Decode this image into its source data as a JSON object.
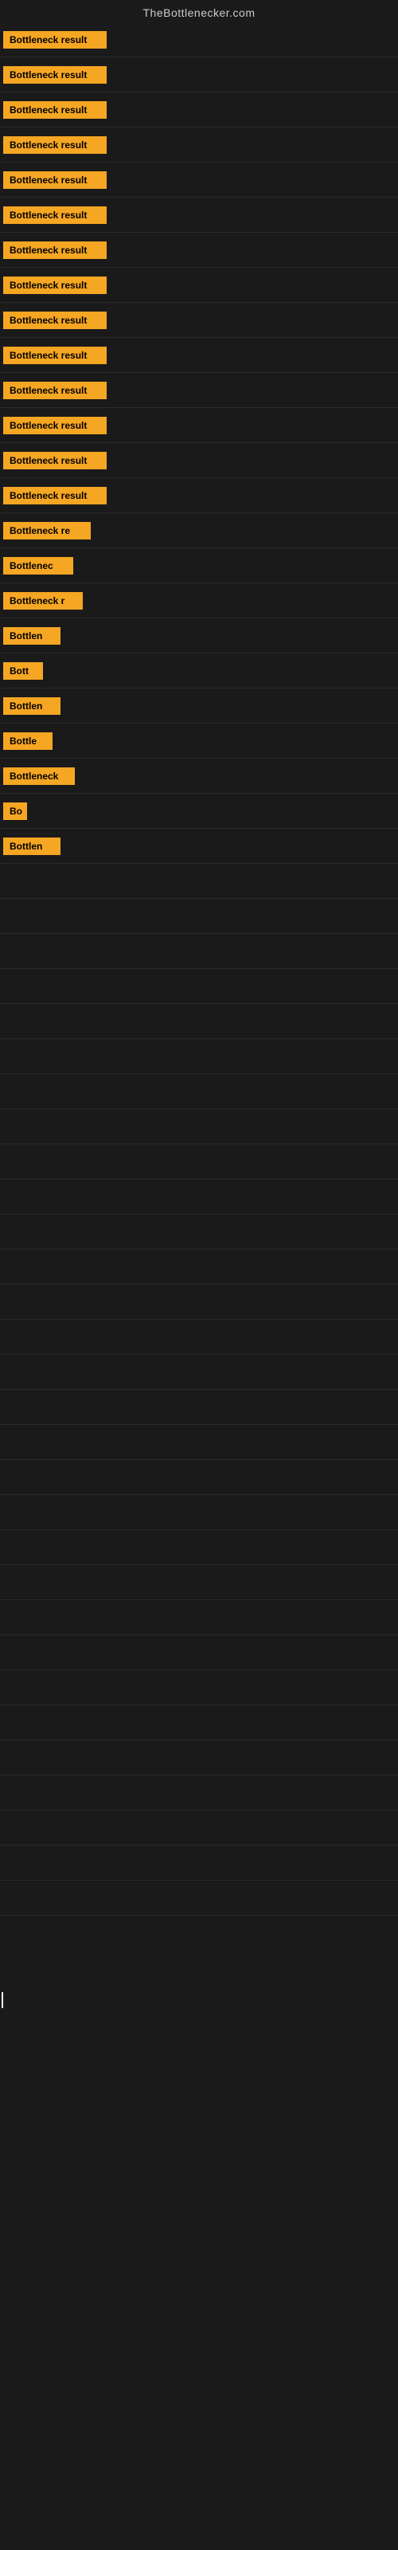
{
  "site": {
    "title": "TheBottlenecker.com"
  },
  "rows": [
    {
      "label": "Bottleneck result",
      "width": 130
    },
    {
      "label": "Bottleneck result",
      "width": 130
    },
    {
      "label": "Bottleneck result",
      "width": 130
    },
    {
      "label": "Bottleneck result",
      "width": 130
    },
    {
      "label": "Bottleneck result",
      "width": 130
    },
    {
      "label": "Bottleneck result",
      "width": 130
    },
    {
      "label": "Bottleneck result",
      "width": 130
    },
    {
      "label": "Bottleneck result",
      "width": 130
    },
    {
      "label": "Bottleneck result",
      "width": 130
    },
    {
      "label": "Bottleneck result",
      "width": 130
    },
    {
      "label": "Bottleneck result",
      "width": 130
    },
    {
      "label": "Bottleneck result",
      "width": 130
    },
    {
      "label": "Bottleneck result",
      "width": 130
    },
    {
      "label": "Bottleneck result",
      "width": 130
    },
    {
      "label": "Bottleneck re",
      "width": 110
    },
    {
      "label": "Bottlenec",
      "width": 88
    },
    {
      "label": "Bottleneck r",
      "width": 100
    },
    {
      "label": "Bottlen",
      "width": 72
    },
    {
      "label": "Bott",
      "width": 50
    },
    {
      "label": "Bottlen",
      "width": 72
    },
    {
      "label": "Bottle",
      "width": 62
    },
    {
      "label": "Bottleneck",
      "width": 90
    },
    {
      "label": "Bo",
      "width": 30
    },
    {
      "label": "Bottlen",
      "width": 72
    }
  ],
  "colors": {
    "bar_bg": "#f5a623",
    "bar_text": "#000000",
    "site_title": "#cccccc",
    "page_bg": "#1a1a1a"
  }
}
